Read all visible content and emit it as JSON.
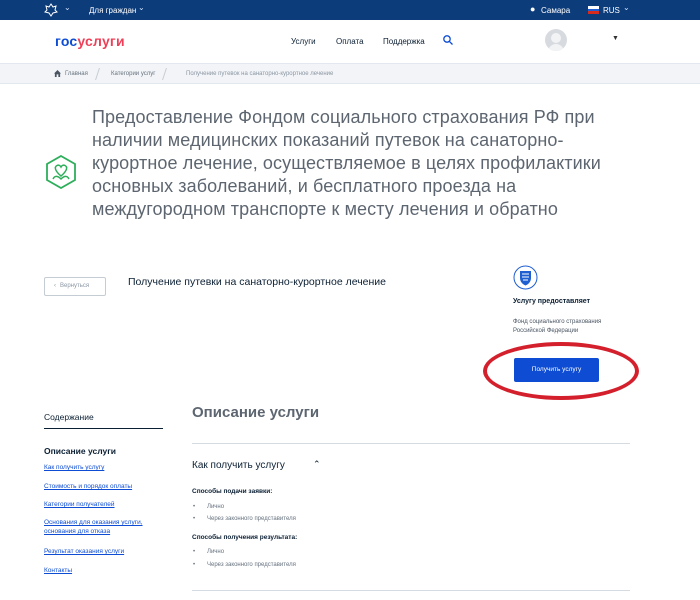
{
  "topbar": {
    "for_citizens": "Для граждан",
    "city": "Самара",
    "lang": "RUS"
  },
  "header": {
    "logo_part1": "гос",
    "logo_part2": "услуги",
    "nav": [
      "Услуги",
      "Оплата",
      "Поддержка"
    ]
  },
  "breadcrumbs": [
    "Главная",
    "Категории услуг",
    "Получение путевок на санаторно-курортное лечение"
  ],
  "service": {
    "title": "Предоставление Фондом социального страхования РФ при наличии медицинских показаний путевок на санаторно-курортное лечение, осуществляемое в целях профилактики основных заболеваний, и бесплатного проезда на междугородном транспорте к месту лечения и обратно",
    "back_label": "Вернуться",
    "subtitle": "Получение путевки на санаторно-курортное лечение"
  },
  "provider": {
    "label": "Услугу предоставляет",
    "name": "Фонд социального страхования Российской Федерации",
    "cta": "Получить услугу"
  },
  "toc": {
    "title": "Содержание",
    "section": "Описание услуги",
    "links": [
      "Как получить услугу",
      "Стоимость и порядок оплаты",
      "Категории получателей",
      "Основания для оказания услуги, основания для отказа",
      "Результат оказания услуги",
      "Контакты"
    ]
  },
  "content": {
    "title": "Описание услуги",
    "how_title": "Как получить услугу",
    "submit_head": "Способы подачи заявки:",
    "submit_items": [
      "Лично",
      "Через законного представителя"
    ],
    "result_head": "Способы получения результата:",
    "result_items": [
      "Лично",
      "Через законного представителя"
    ]
  },
  "colors": {
    "topbar": "#0d3c7b",
    "accent": "#0d4cd3",
    "logo_red": "#ee3f58",
    "highlight_ring": "#d4202c",
    "service_icon": "#2dae5a"
  },
  "icons": [
    "emblem-icon",
    "chevron-down-icon",
    "location-pin-icon",
    "flag-icon",
    "search-icon",
    "avatar",
    "home-icon",
    "service-family-icon",
    "back-arrow-icon",
    "fss-logo-icon",
    "chevron-up-icon"
  ]
}
